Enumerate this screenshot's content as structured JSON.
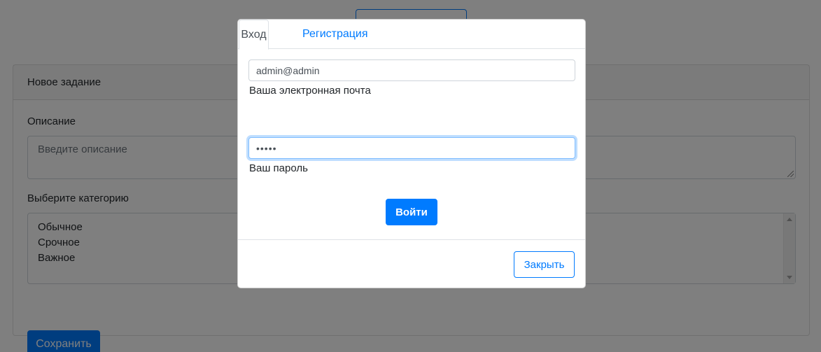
{
  "background": {
    "card": {
      "header": "Новое задание",
      "description_label": "Описание",
      "description_placeholder": "Введите описание",
      "category_label": "Выберите категорию",
      "category_options": [
        "Обычное",
        "Срочное",
        "Важное"
      ],
      "save_label": "Сохранить"
    }
  },
  "modal": {
    "tabs": [
      {
        "label": "Вход",
        "active": true
      },
      {
        "label": "Регистрация",
        "active": false
      }
    ],
    "email_value": "admin@admin",
    "email_help": "Ваша электронная почта",
    "password_mask": "•••••",
    "password_help": "Ваш пароль",
    "login_label": "Войти",
    "close_label": "Закрыть"
  },
  "colors": {
    "primary": "#007bff",
    "backdrop": "rgba(0,0,0,0.5)"
  }
}
